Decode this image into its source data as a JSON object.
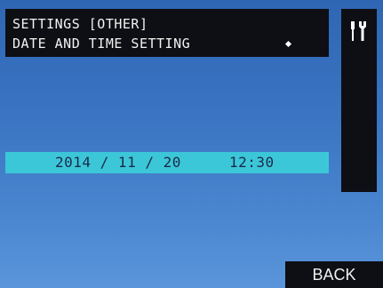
{
  "header": {
    "title_line1": "SETTINGS [OTHER]",
    "title_line2": "DATE AND TIME SETTING"
  },
  "side_panel": {
    "icon": "tools-icon"
  },
  "datetime": {
    "date": "2014 / 11 / 20",
    "time": "12:30"
  },
  "footer": {
    "back_label": "BACK"
  },
  "colors": {
    "background": "#3a74c2",
    "panel": "#0d0f14",
    "highlight": "#3cc7d8",
    "text": "#ffffff"
  }
}
